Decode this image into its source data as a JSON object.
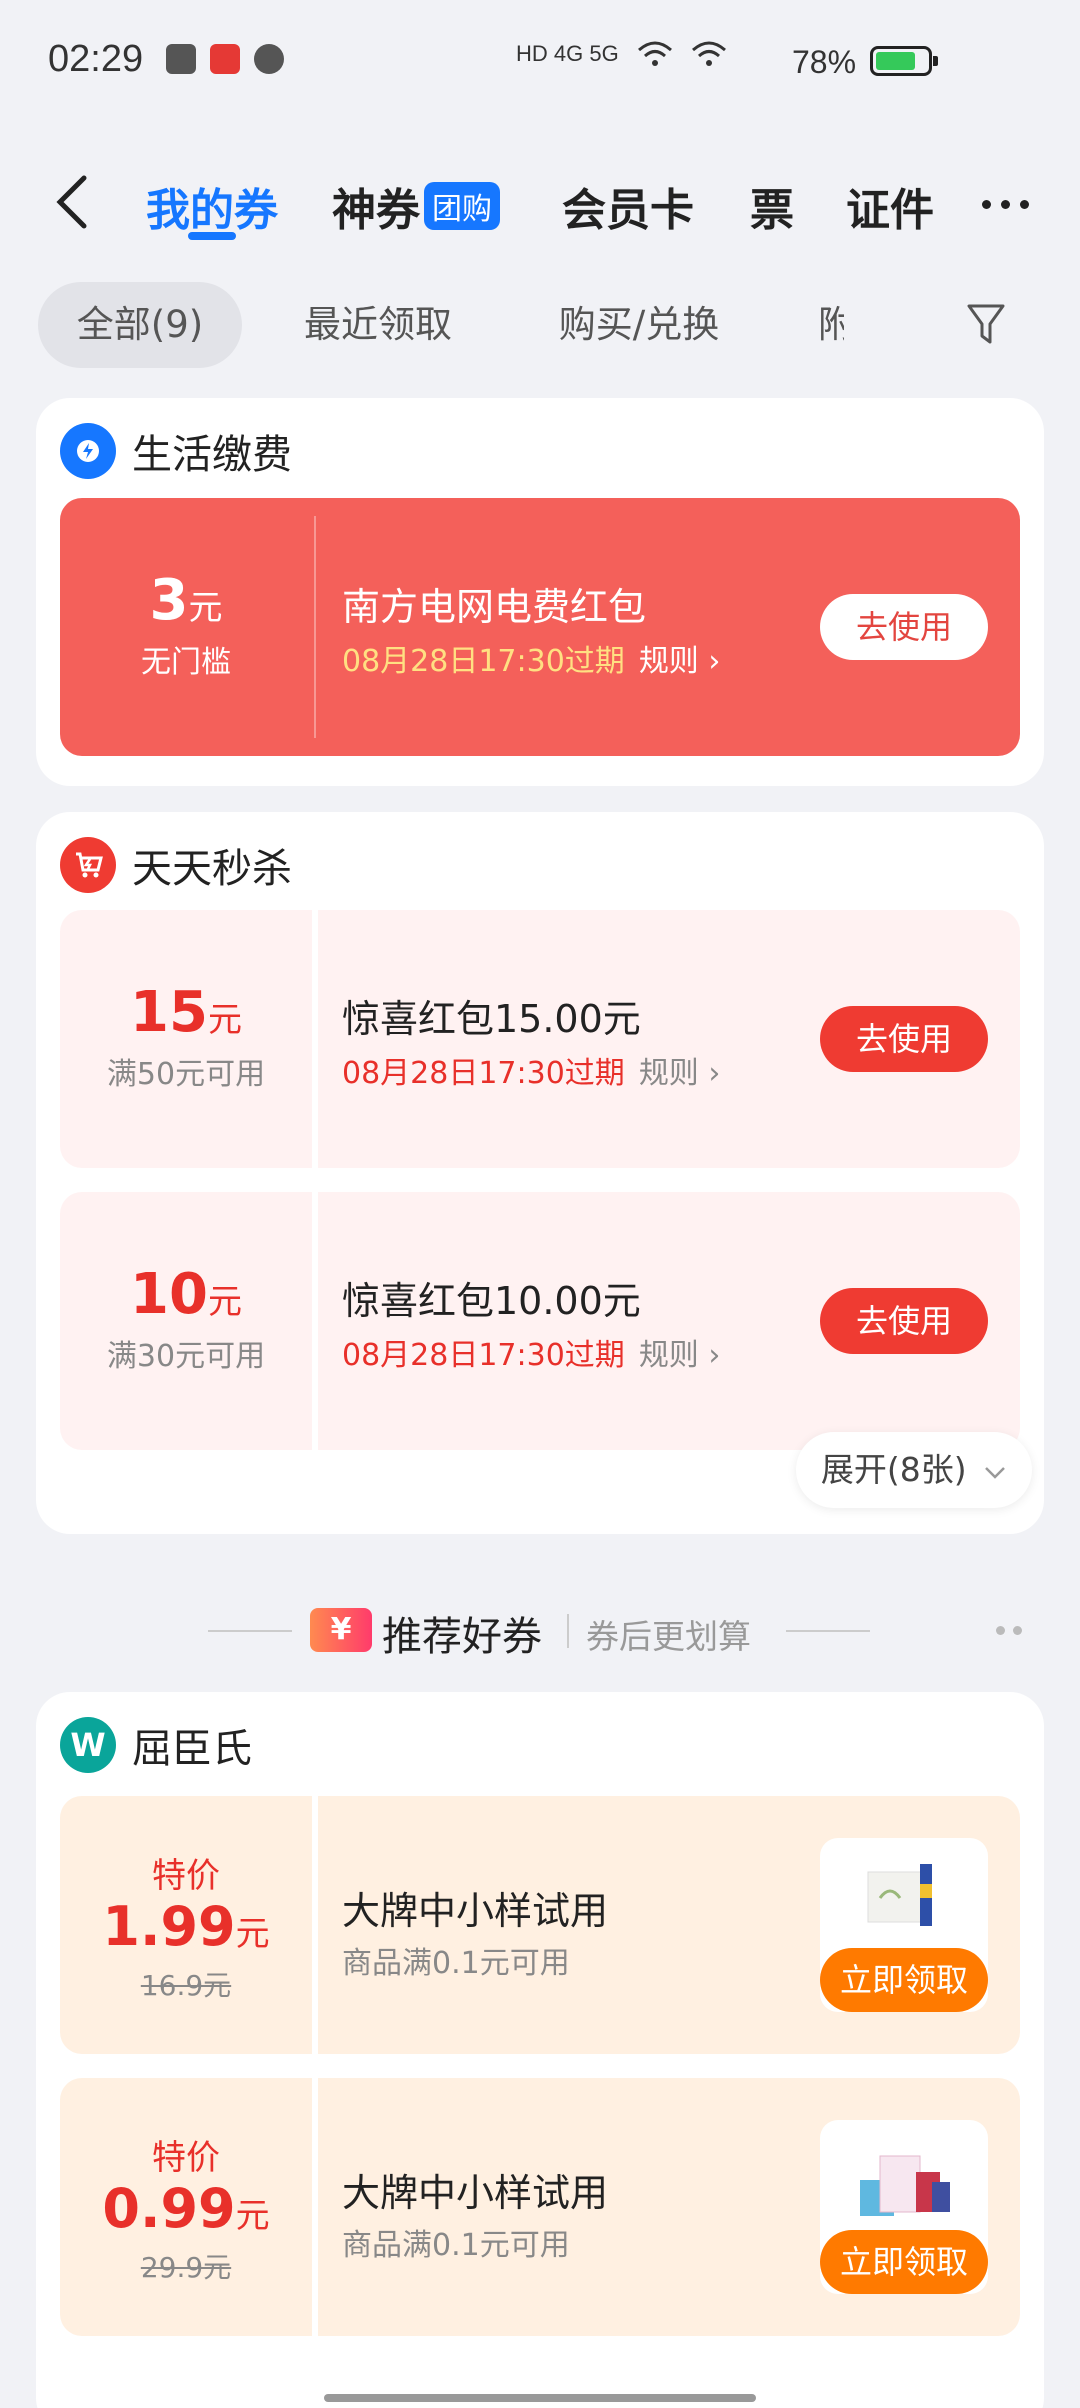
{
  "status_bar": {
    "time": "02:29",
    "network": "HD 4G 5G",
    "battery_percent": "78%",
    "battery_level": 0.78
  },
  "nav": {
    "tabs": [
      {
        "label": "我的券"
      },
      {
        "label": "神券",
        "badge": "团购"
      },
      {
        "label": "会员卡"
      },
      {
        "label": "票"
      },
      {
        "label": "证件"
      }
    ]
  },
  "filters": {
    "chips": [
      "全部(9)",
      "最近领取",
      "购买/兑换",
      "附"
    ]
  },
  "section_life": {
    "title": "生活缴费",
    "coupon": {
      "amount": "3",
      "unit": "元",
      "condition": "无门槛",
      "title": "南方电网电费红包",
      "expiry": "08月28日17:30过期",
      "rule": "规则",
      "button": "去使用"
    }
  },
  "section_flash": {
    "title": "天天秒杀",
    "coupons": [
      {
        "amount": "15",
        "unit": "元",
        "condition": "满50元可用",
        "title": "惊喜红包15.00元",
        "expiry": "08月28日17:30过期",
        "rule": "规则",
        "button": "去使用"
      },
      {
        "amount": "10",
        "unit": "元",
        "condition": "满30元可用",
        "title": "惊喜红包10.00元",
        "expiry": "08月28日17:30过期",
        "rule": "规则",
        "button": "去使用"
      }
    ],
    "expand": "展开(8张)"
  },
  "recommend": {
    "icon": "¥",
    "title": "推荐好券",
    "subtitle": "券后更划算"
  },
  "section_watsons": {
    "title": "屈臣氏",
    "logo": "W",
    "coupons": [
      {
        "tag": "特价",
        "price": "1.99",
        "unit": "元",
        "original": "16.9元",
        "title": "大牌中小样试用",
        "condition": "商品满0.1元可用",
        "button": "立即领取"
      },
      {
        "tag": "特价",
        "price": "0.99",
        "unit": "元",
        "original": "29.9元",
        "title": "大牌中小样试用",
        "condition": "商品满0.1元可用",
        "button": "立即领取"
      }
    ]
  },
  "colors": {
    "accent": "#1677ff",
    "red_card": "#f4605a",
    "red_button": "#ef3b32",
    "orange_button": "#ff7a00"
  }
}
